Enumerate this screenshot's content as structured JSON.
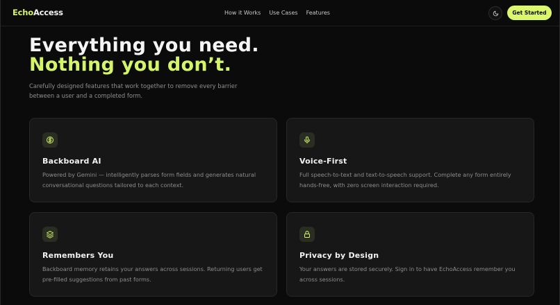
{
  "nav": {
    "logo_echo": "Echo",
    "logo_access": "Access",
    "links": [
      "How it Works",
      "Use Cases",
      "Features"
    ],
    "theme_toggle_icon": "moon-icon",
    "cta_label": "Get Started"
  },
  "hero": {
    "title_line1": "Everything you need.",
    "title_line2": "Nothing you don’t.",
    "subtitle": "Carefully designed features that work together to remove every barrier between a user and a completed form."
  },
  "features": [
    {
      "icon": "brain-icon",
      "title": "Backboard AI",
      "description": "Powered by Gemini — intelligently parses form fields and generates natural conversational questions tailored to each context."
    },
    {
      "icon": "microphone-icon",
      "title": "Voice-First",
      "description": "Full speech-to-text and text-to-speech support. Complete any form entirely hands-free, with zero screen interaction required."
    },
    {
      "icon": "layers-icon",
      "title": "Remembers You",
      "description": "Backboard memory retains your answers across sessions. Returning users get pre-filled suggestions from past forms."
    },
    {
      "icon": "lock-icon",
      "title": "Privacy by Design",
      "description": "Your answers are stored securely. Sign in to have EchoAccess remember you across sessions."
    }
  ],
  "colors": {
    "accent": "#d4f56a",
    "background": "#0b0b0b",
    "card": "#171717"
  }
}
